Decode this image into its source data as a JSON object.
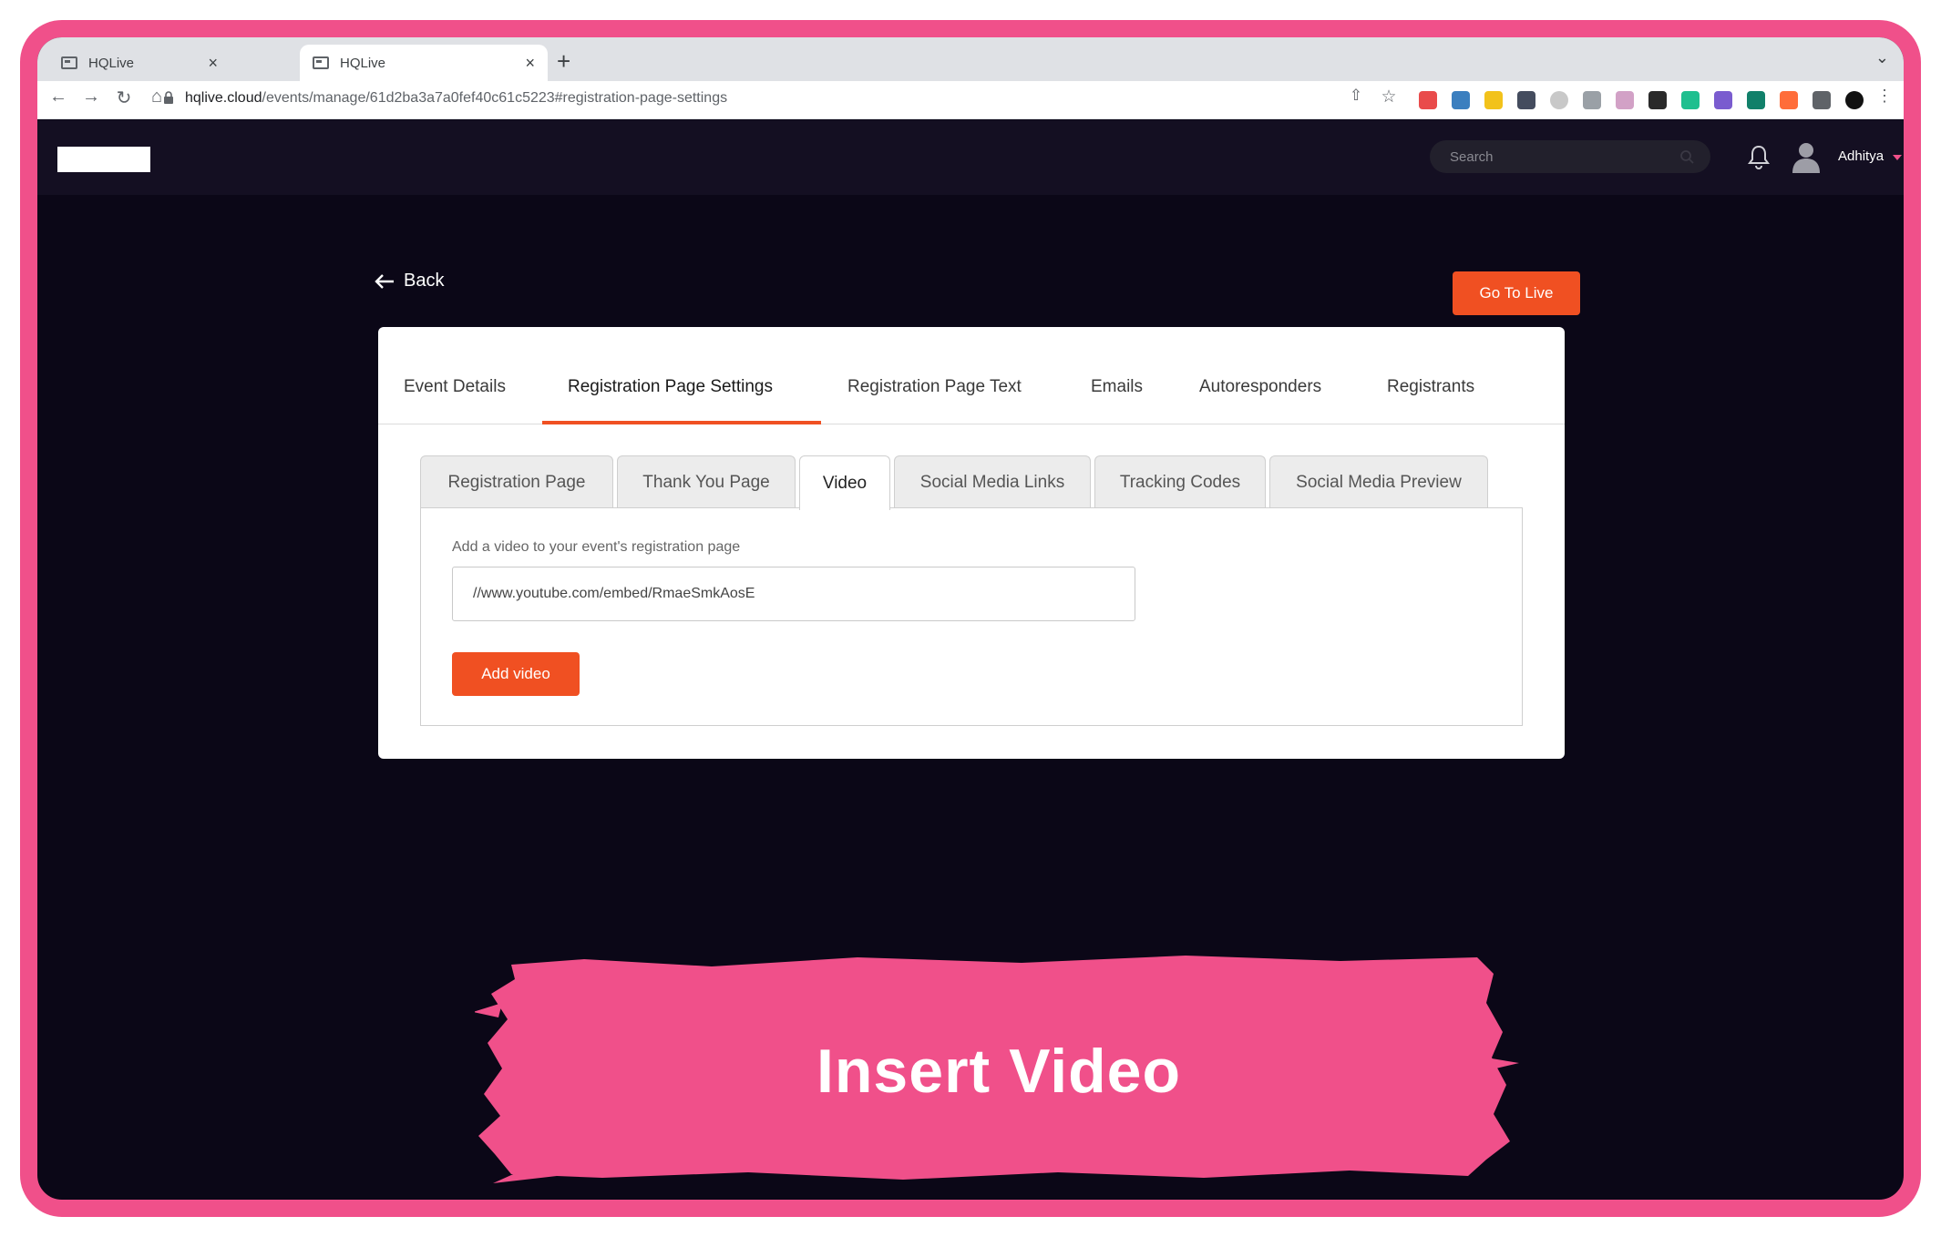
{
  "browser": {
    "tabs": [
      {
        "title": "HQLive",
        "active": false
      },
      {
        "title": "HQLive",
        "active": true
      }
    ],
    "close_glyph": "×",
    "new_tab_glyph": "+",
    "tab_menu_glyph": "⌄",
    "url_host": "hqlive.cloud",
    "url_path": "/events/manage/61d2ba3a7a0fef40c61c5223#registration-page-settings"
  },
  "header": {
    "search_placeholder": "Search",
    "username": "Adhitya"
  },
  "page": {
    "back_label": "Back",
    "go_live_label": "Go To Live"
  },
  "main_tabs": [
    {
      "label": "Event Details",
      "active": false
    },
    {
      "label": "Registration Page Settings",
      "active": true
    },
    {
      "label": "Registration Page Text",
      "active": false
    },
    {
      "label": "Emails",
      "active": false
    },
    {
      "label": "Autoresponders",
      "active": false
    },
    {
      "label": "Registrants",
      "active": false
    }
  ],
  "sub_tabs": [
    {
      "label": "Registration Page",
      "active": false
    },
    {
      "label": "Thank You Page",
      "active": false
    },
    {
      "label": "Video",
      "active": true
    },
    {
      "label": "Social Media Links",
      "active": false
    },
    {
      "label": "Tracking Codes",
      "active": false
    },
    {
      "label": "Social Media Preview",
      "active": false
    }
  ],
  "video_panel": {
    "label": "Add a video to your event's registration page",
    "url_value": "//www.youtube.com/embed/RmaeSmkAosE",
    "add_button": "Add video"
  },
  "banner": {
    "text": "Insert Video"
  },
  "colors": {
    "accent": "#f05022",
    "frame": "#f0508a",
    "background": "#0b0717",
    "banner": "#f0508a"
  }
}
